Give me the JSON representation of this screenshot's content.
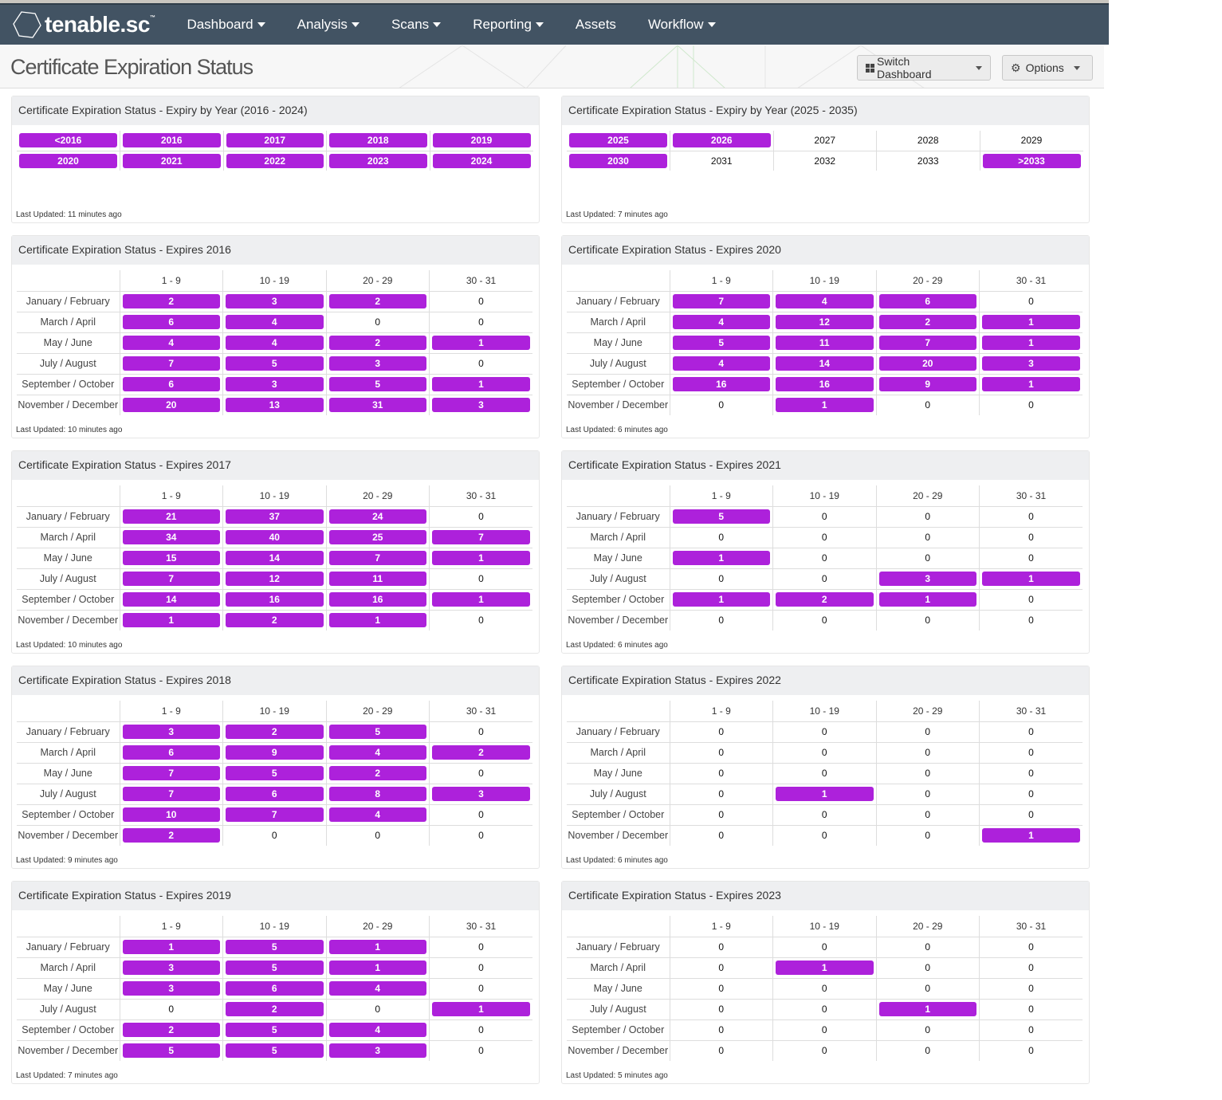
{
  "app": {
    "logo_text": "tenable.sc",
    "nav": [
      {
        "label": "Dashboard",
        "dropdown": true
      },
      {
        "label": "Analysis",
        "dropdown": true
      },
      {
        "label": "Scans",
        "dropdown": true
      },
      {
        "label": "Reporting",
        "dropdown": true
      },
      {
        "label": "Assets",
        "dropdown": false
      },
      {
        "label": "Workflow",
        "dropdown": true
      }
    ]
  },
  "page": {
    "title": "Certificate Expiration Status",
    "switch_dashboard_label": "Switch Dashboard",
    "options_label": "Options",
    "options_icon": "gear-icon",
    "switch_icon": "grid-icon"
  },
  "colors": {
    "accent": "#ad21db",
    "navbar": "#425363"
  },
  "year_panels": [
    {
      "title": "Certificate Expiration Status - Expiry by Year (2016 - 2024)",
      "last_updated": "Last Updated: 11 minutes ago",
      "rows": [
        [
          {
            "label": "<2016",
            "hit": true
          },
          {
            "label": "2016",
            "hit": true
          },
          {
            "label": "2017",
            "hit": true
          },
          {
            "label": "2018",
            "hit": true
          },
          {
            "label": "2019",
            "hit": true
          }
        ],
        [
          {
            "label": "2020",
            "hit": true
          },
          {
            "label": "2021",
            "hit": true
          },
          {
            "label": "2022",
            "hit": true
          },
          {
            "label": "2023",
            "hit": true
          },
          {
            "label": "2024",
            "hit": true
          }
        ]
      ]
    },
    {
      "title": "Certificate Expiration Status - Expiry by Year (2025 - 2035)",
      "last_updated": "Last Updated: 7 minutes ago",
      "rows": [
        [
          {
            "label": "2025",
            "hit": true
          },
          {
            "label": "2026",
            "hit": true
          },
          {
            "label": "2027",
            "hit": false
          },
          {
            "label": "2028",
            "hit": false
          },
          {
            "label": "2029",
            "hit": false
          }
        ],
        [
          {
            "label": "2030",
            "hit": true
          },
          {
            "label": "2031",
            "hit": false
          },
          {
            "label": "2032",
            "hit": false
          },
          {
            "label": "2033",
            "hit": false
          },
          {
            "label": ">2033",
            "hit": true
          }
        ]
      ]
    }
  ],
  "matrix_columns": [
    "1 - 9",
    "10 - 19",
    "20 - 29",
    "30 - 31"
  ],
  "matrix_rows": [
    "January / February",
    "March / April",
    "May / June",
    "July / August",
    "September / October",
    "November / December"
  ],
  "matrix_panels": [
    {
      "title": "Certificate Expiration Status - Expires 2016",
      "last_updated": "Last Updated: 10 minutes ago",
      "values": [
        [
          2,
          3,
          2,
          0
        ],
        [
          6,
          4,
          0,
          0
        ],
        [
          4,
          4,
          2,
          1
        ],
        [
          7,
          5,
          3,
          0
        ],
        [
          6,
          3,
          5,
          1
        ],
        [
          20,
          13,
          31,
          3
        ]
      ]
    },
    {
      "title": "Certificate Expiration Status - Expires 2020",
      "last_updated": "Last Updated: 6 minutes ago",
      "values": [
        [
          7,
          4,
          6,
          0
        ],
        [
          4,
          12,
          2,
          1
        ],
        [
          5,
          11,
          7,
          1
        ],
        [
          4,
          14,
          20,
          3
        ],
        [
          16,
          16,
          9,
          1
        ],
        [
          0,
          1,
          0,
          0
        ]
      ]
    },
    {
      "title": "Certificate Expiration Status - Expires 2017",
      "last_updated": "Last Updated: 10 minutes ago",
      "values": [
        [
          21,
          37,
          24,
          0
        ],
        [
          34,
          40,
          25,
          7
        ],
        [
          15,
          14,
          7,
          1
        ],
        [
          7,
          12,
          11,
          0
        ],
        [
          14,
          16,
          16,
          1
        ],
        [
          1,
          2,
          1,
          0
        ]
      ]
    },
    {
      "title": "Certificate Expiration Status - Expires 2021",
      "last_updated": "Last Updated: 6 minutes ago",
      "values": [
        [
          5,
          0,
          0,
          0
        ],
        [
          0,
          0,
          0,
          0
        ],
        [
          1,
          0,
          0,
          0
        ],
        [
          0,
          0,
          3,
          1
        ],
        [
          1,
          2,
          1,
          0
        ],
        [
          0,
          0,
          0,
          0
        ]
      ]
    },
    {
      "title": "Certificate Expiration Status - Expires 2018",
      "last_updated": "Last Updated: 9 minutes ago",
      "values": [
        [
          3,
          2,
          5,
          0
        ],
        [
          6,
          9,
          4,
          2
        ],
        [
          7,
          5,
          2,
          0
        ],
        [
          7,
          6,
          8,
          3
        ],
        [
          10,
          7,
          4,
          0
        ],
        [
          2,
          0,
          0,
          0
        ]
      ]
    },
    {
      "title": "Certificate Expiration Status - Expires 2022",
      "last_updated": "Last Updated: 6 minutes ago",
      "values": [
        [
          0,
          0,
          0,
          0
        ],
        [
          0,
          0,
          0,
          0
        ],
        [
          0,
          0,
          0,
          0
        ],
        [
          0,
          1,
          0,
          0
        ],
        [
          0,
          0,
          0,
          0
        ],
        [
          0,
          0,
          0,
          1
        ]
      ]
    },
    {
      "title": "Certificate Expiration Status - Expires 2019",
      "last_updated": "Last Updated: 7 minutes ago",
      "values": [
        [
          1,
          5,
          1,
          0
        ],
        [
          3,
          5,
          1,
          0
        ],
        [
          3,
          6,
          4,
          0
        ],
        [
          0,
          2,
          0,
          1
        ],
        [
          2,
          5,
          4,
          0
        ],
        [
          5,
          5,
          3,
          0
        ]
      ]
    },
    {
      "title": "Certificate Expiration Status - Expires 2023",
      "last_updated": "Last Updated: 5 minutes ago",
      "values": [
        [
          0,
          0,
          0,
          0
        ],
        [
          0,
          1,
          0,
          0
        ],
        [
          0,
          0,
          0,
          0
        ],
        [
          0,
          0,
          1,
          0
        ],
        [
          0,
          0,
          0,
          0
        ],
        [
          0,
          0,
          0,
          0
        ]
      ]
    }
  ]
}
